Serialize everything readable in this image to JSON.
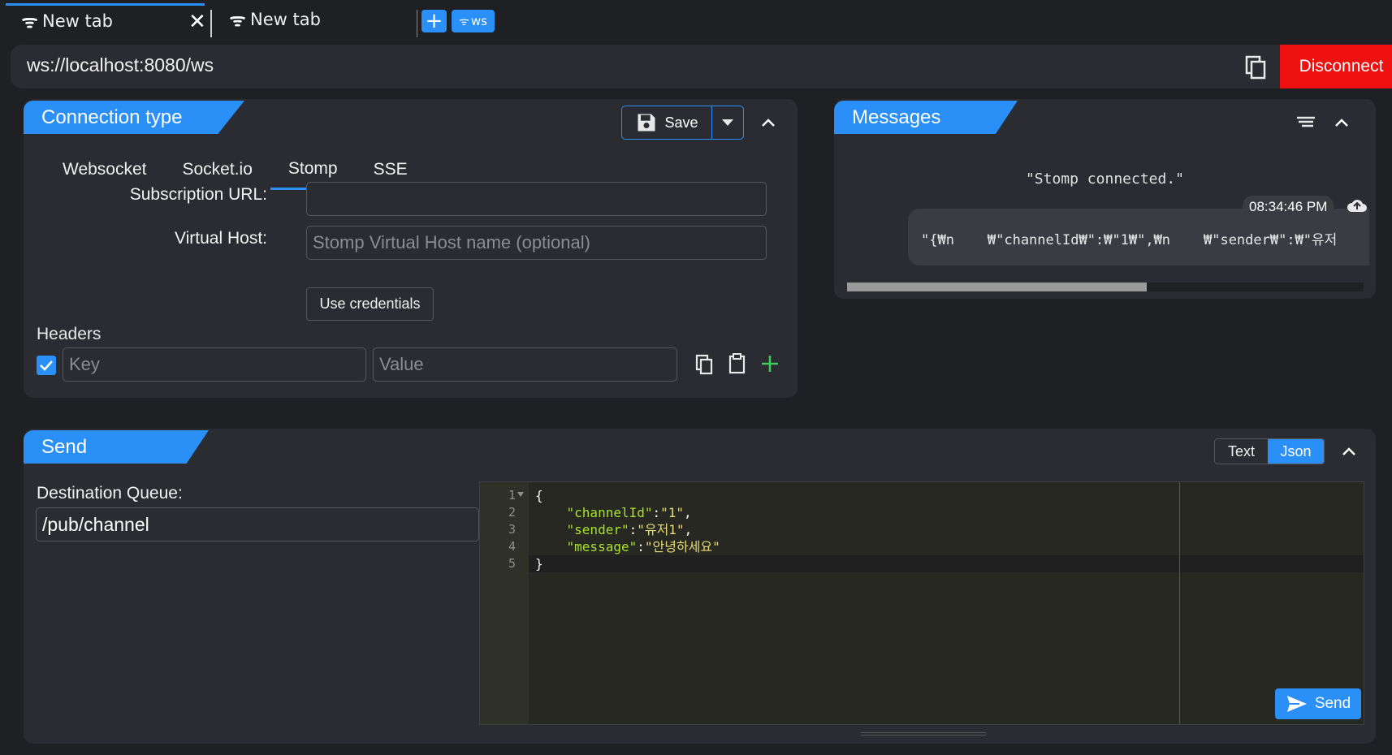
{
  "tabs": [
    {
      "label": "New tab",
      "active": true,
      "close_icon": "close-icon"
    },
    {
      "label": "New tab",
      "active": false
    }
  ],
  "tab_actions": {
    "add_label": "+",
    "ws_label": "ws"
  },
  "url_bar": {
    "url": "ws://localhost:8080/ws",
    "disconnect_label": "Disconnect"
  },
  "connection": {
    "title": "Connection type",
    "save_label": "Save",
    "tabs": [
      "Websocket",
      "Socket.io",
      "Stomp",
      "SSE"
    ],
    "active_tab": "Stomp",
    "subscription_url_label": "Subscription URL:",
    "subscription_url_value": "",
    "virtual_host_label": "Virtual Host:",
    "virtual_host_placeholder": "Stomp Virtual Host name (optional)",
    "use_credentials_label": "Use credentials",
    "headers_label": "Headers",
    "header_key_placeholder": "Key",
    "header_value_placeholder": "Value",
    "header_enabled": true
  },
  "messages": {
    "title": "Messages",
    "system_message": "\"Stomp connected.\"",
    "message_time": "08:34:46 PM",
    "message_text": "\"{₩n    ₩\"channelId₩\":₩\"1₩\",₩n    ₩\"sender₩\":₩\"유저",
    "scroll_position": 0.58
  },
  "send": {
    "title": "Send",
    "format_options": [
      "Text",
      "Json"
    ],
    "active_format": "Json",
    "destination_label": "Destination Queue:",
    "destination_value": "/pub/channel",
    "editor_line_numbers": [
      "1",
      "2",
      "3",
      "4",
      "5"
    ],
    "editor_lines": [
      "{",
      "    \"channelId\":\"1\",",
      "    \"sender\":\"유저1\",",
      "    \"message\":\"안녕하세요\"",
      "}"
    ],
    "send_label": "Send"
  },
  "colors": {
    "accent": "#2a8ff7",
    "danger": "#ef1010",
    "panel": "#2b2c31",
    "background": "#1f2024"
  }
}
